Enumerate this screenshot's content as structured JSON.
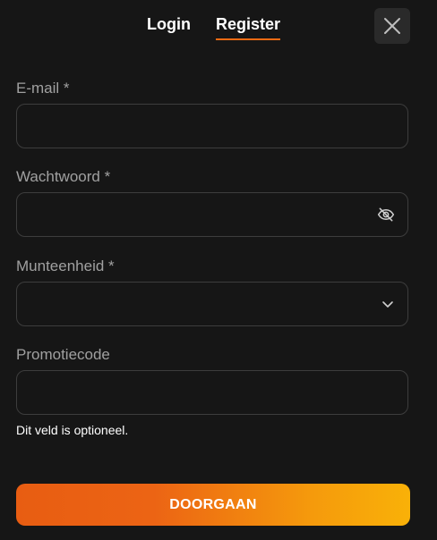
{
  "tabs": {
    "login_label": "Login",
    "register_label": "Register",
    "active": "Register"
  },
  "close": {
    "icon": "close-icon"
  },
  "fields": {
    "email": {
      "label": "E-mail *",
      "value": "",
      "placeholder": ""
    },
    "password": {
      "label": "Wachtwoord *",
      "value": "",
      "placeholder": "",
      "icon": "eye-off-icon"
    },
    "currency": {
      "label": "Munteenheid *",
      "selected": "",
      "icon": "chevron-down-icon"
    },
    "promo": {
      "label": "Promotiecode",
      "value": "",
      "placeholder": "",
      "helper": "Dit veld is optioneel."
    }
  },
  "submit": {
    "label": "DOORGAAN"
  },
  "colors": {
    "background": "#161616",
    "accent": "#f26a13",
    "button_gradient_start": "#e85d12",
    "button_gradient_end": "#f9b108",
    "field_border": "#3d3d3d",
    "label": "#a0a0a0"
  }
}
